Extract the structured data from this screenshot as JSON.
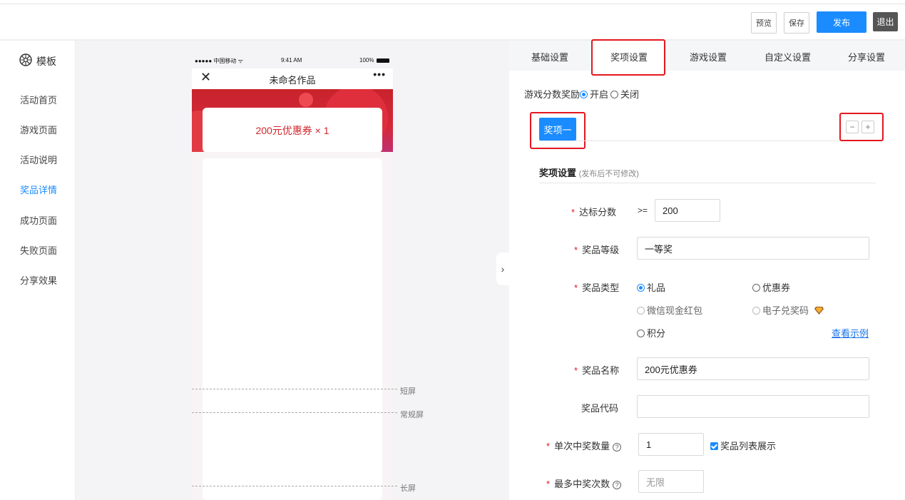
{
  "toolbar": {
    "preview_label": "预览",
    "save_label": "保存",
    "publish_label": "发布",
    "exit_label": "退出"
  },
  "sidebar": {
    "header": "模板",
    "items": [
      {
        "label": "活动首页"
      },
      {
        "label": "游戏页面"
      },
      {
        "label": "活动说明"
      },
      {
        "label": "奖品详情"
      },
      {
        "label": "成功页面"
      },
      {
        "label": "失败页面"
      },
      {
        "label": "分享效果"
      }
    ]
  },
  "phone": {
    "carrier": "●●●●● 中国移动 ᯤ",
    "time": "9:41 AM",
    "battery": "100%",
    "title": "未命名作品",
    "close": "✕",
    "more": "•••",
    "coupon_text": "200元优惠券  × 1",
    "guides": [
      "短屏",
      "常规屏",
      "长屏"
    ]
  },
  "tabs": [
    {
      "label": "基础设置"
    },
    {
      "label": "奖项设置"
    },
    {
      "label": "游戏设置"
    },
    {
      "label": "自定义设置"
    },
    {
      "label": "分享设置"
    }
  ],
  "form": {
    "score_reward_label": "游戏分数奖励",
    "on_label": "开启",
    "off_label": "关闭",
    "prize_tab": "奖项一",
    "minus": "−",
    "plus": "+",
    "section_title": "奖项设置",
    "section_note": "(发布后不可修改)",
    "target_score_label": "达标分数",
    "target_score_op": ">=",
    "target_score_value": "200",
    "prize_level_label": "奖品等级",
    "prize_level_value": "一等奖",
    "prize_type_label": "奖品类型",
    "prize_types": {
      "gift": "礼品",
      "coupon": "优惠券",
      "wechat_cash": "微信现金红包",
      "e_code": "电子兑奖码",
      "points": "积分"
    },
    "view_example": "查看示例",
    "prize_name_label": "奖品名称",
    "prize_name_value": "200元优惠券",
    "prize_code_label": "奖品代码",
    "prize_code_value": "",
    "per_win_qty_label": "单次中奖数量",
    "per_win_qty_value": "1",
    "show_in_list_label": "奖品列表展示",
    "max_wins_label": "最多中奖次数",
    "max_wins_placeholder": "无限",
    "help": "?"
  },
  "colors": {
    "accent": "#1a8cff",
    "highlight": "#e4161f",
    "coupon_text": "#d4252b"
  }
}
